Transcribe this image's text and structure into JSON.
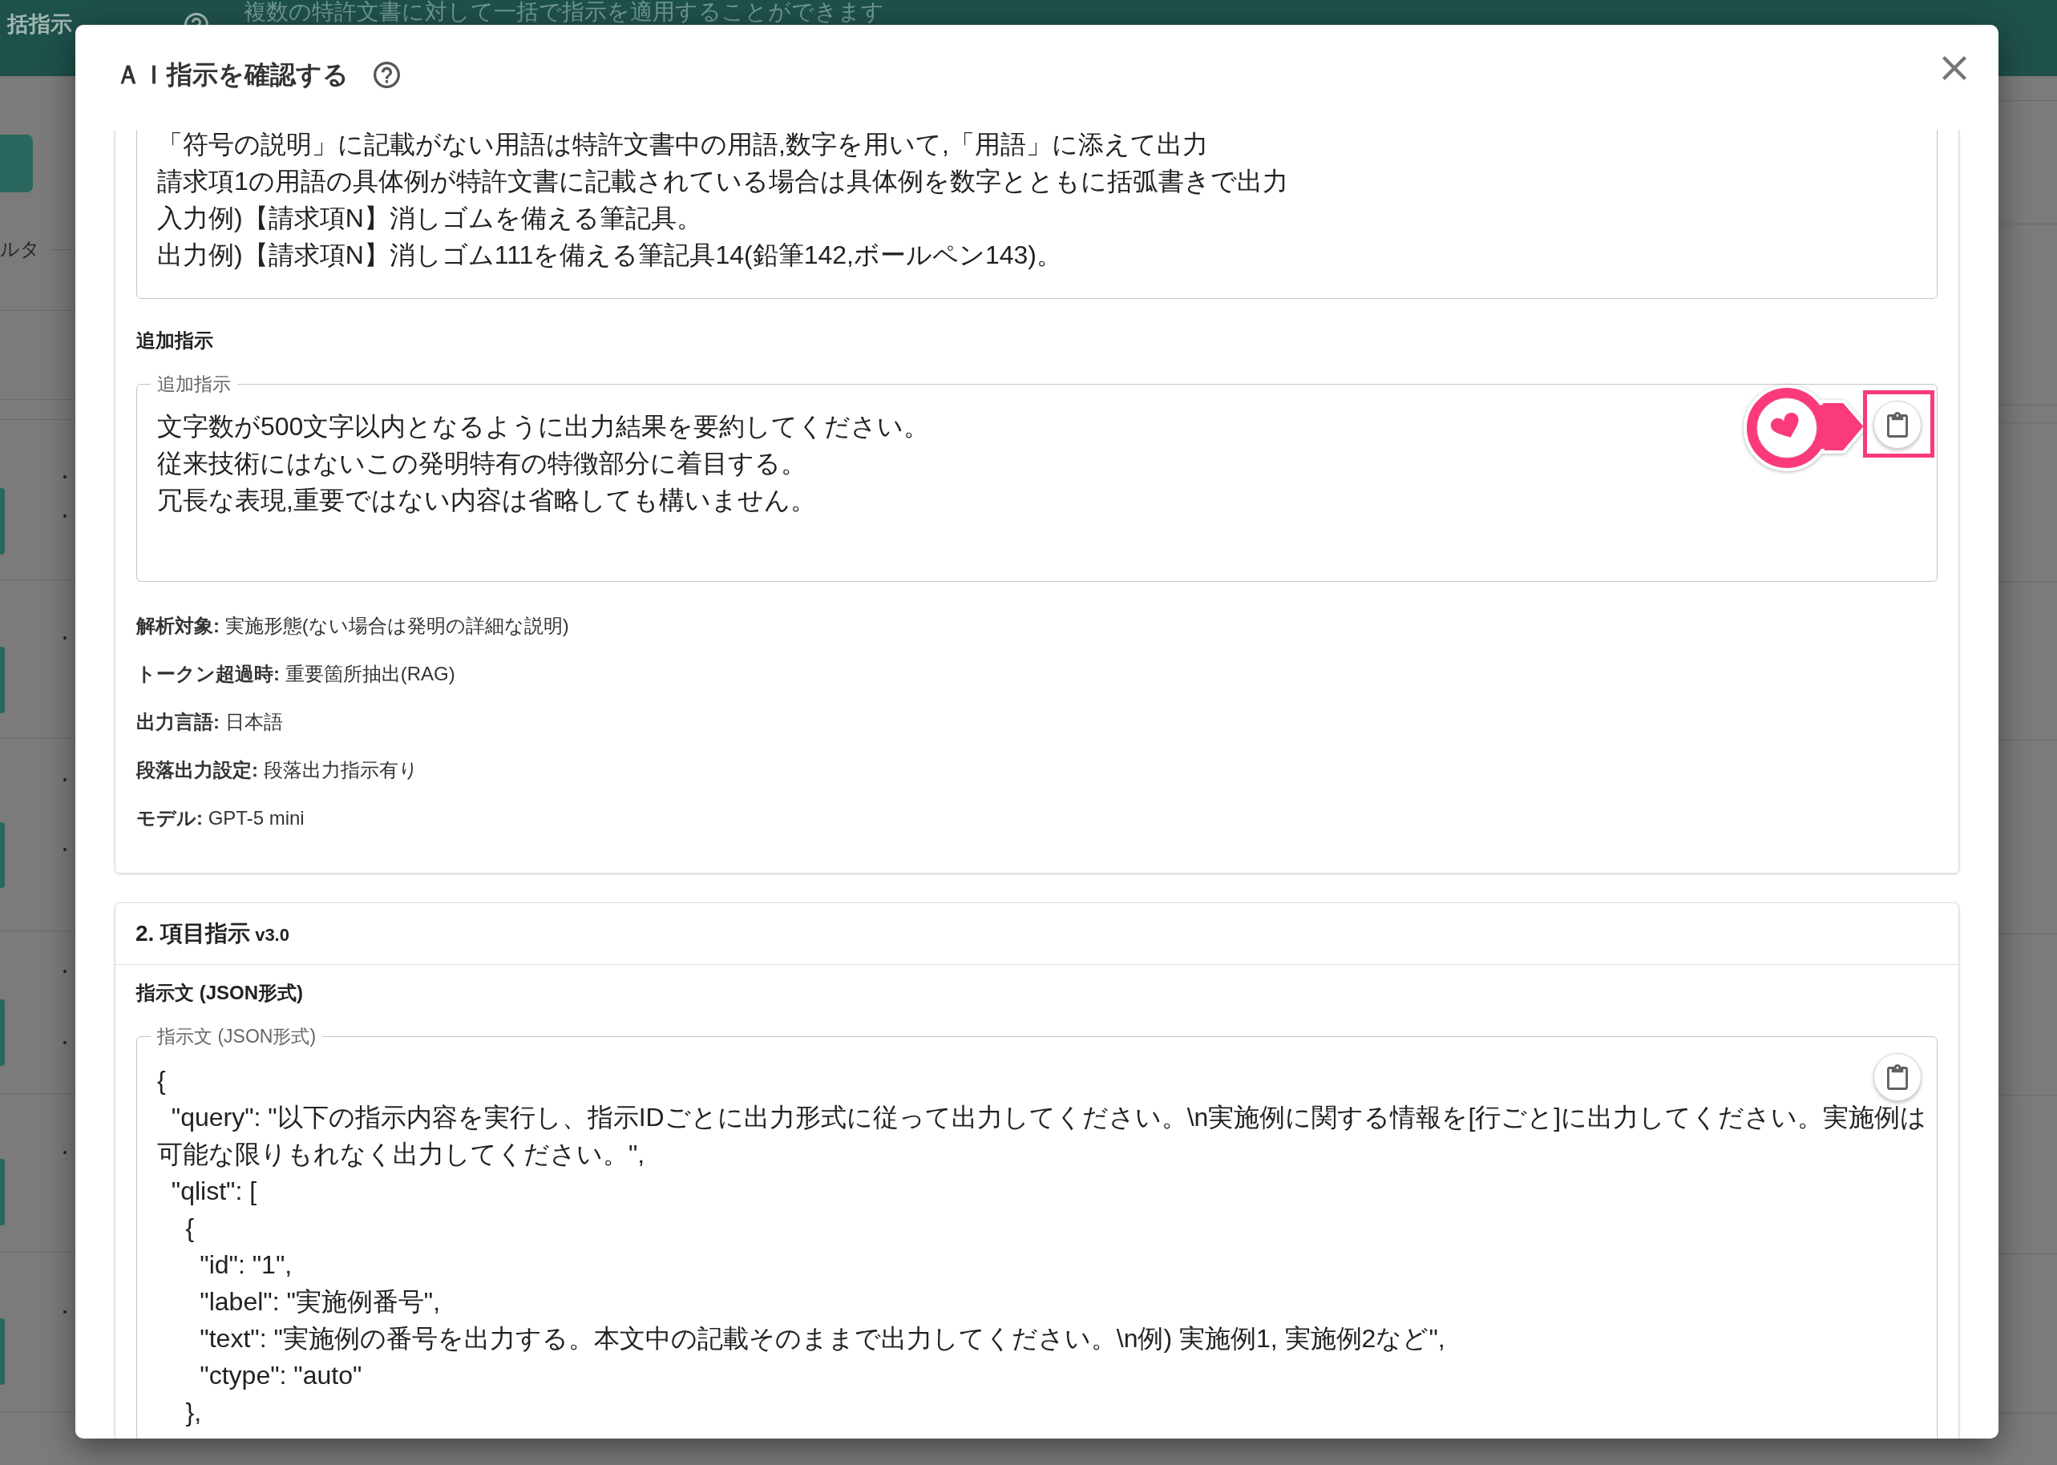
{
  "background_page": {
    "title": "括指示",
    "subtitle": "複数の特許文書に対して一括で指示を適用することができます",
    "filter_label": "ルタ"
  },
  "dialog": {
    "title": "ＡＩ指示を確認する",
    "upper_text_area": {
      "lines": [
        "「符号の説明」に記載がない用語は特許文書中の用語,数字を用いて,「用語」に添えて出力",
        "請求項1の用語の具体例が特許文書に記載されている場合は具体例を数字とともに括弧書きで出力",
        "入力例)【請求項N】消しゴムを備える筆記具。",
        "出力例)【請求項N】消しゴム111を備える筆記具14(鉛筆142,ボールペン143)。"
      ]
    },
    "additional_instruction": {
      "heading": "追加指示",
      "legend": "追加指示",
      "lines": [
        "文字数が500文字以内となるように出力結果を要約してください。",
        "従来技術にはないこの発明特有の特徴部分に着目する。",
        "冗長な表現,重要ではない内容は省略しても構いません。"
      ],
      "copy_button": {
        "highlighted": true
      }
    },
    "settings": [
      "**解析対象:** 実施形態(ない場合は発明の詳細な説明)",
      "**トークン超過時:** 重要箇所抽出(RAG)",
      "**出力言語:** 日本語",
      "**段落出力設定:** 段落出力指示有り",
      "**モデル:** GPT-5 mini"
    ],
    "section_2": {
      "title": "2. 項目指示",
      "version": "v3.0",
      "heading": "指示文 (JSON形式)",
      "legend": "指示文 (JSON形式)",
      "lines": [
        "{",
        "  \"query\": \"以下の指示内容を実行し、指示IDごとに出力形式に従って出力してください。\\n実施例に関する情報を[行ごと]に出力してください。実施例は",
        "可能な限りもれなく出力してください。\",",
        "  \"qlist\": [",
        "    {",
        "      \"id\": \"1\",",
        "      \"label\": \"実施例番号\",",
        "      \"text\": \"実施例の番号を出力する。本文中の記載そのままで出力してください。\\n例) 実施例1, 実施例2など\",",
        "      \"ctype\": \"auto\"",
        "    },"
      ],
      "copy_button": {
        "highlighted": false
      }
    }
  }
}
